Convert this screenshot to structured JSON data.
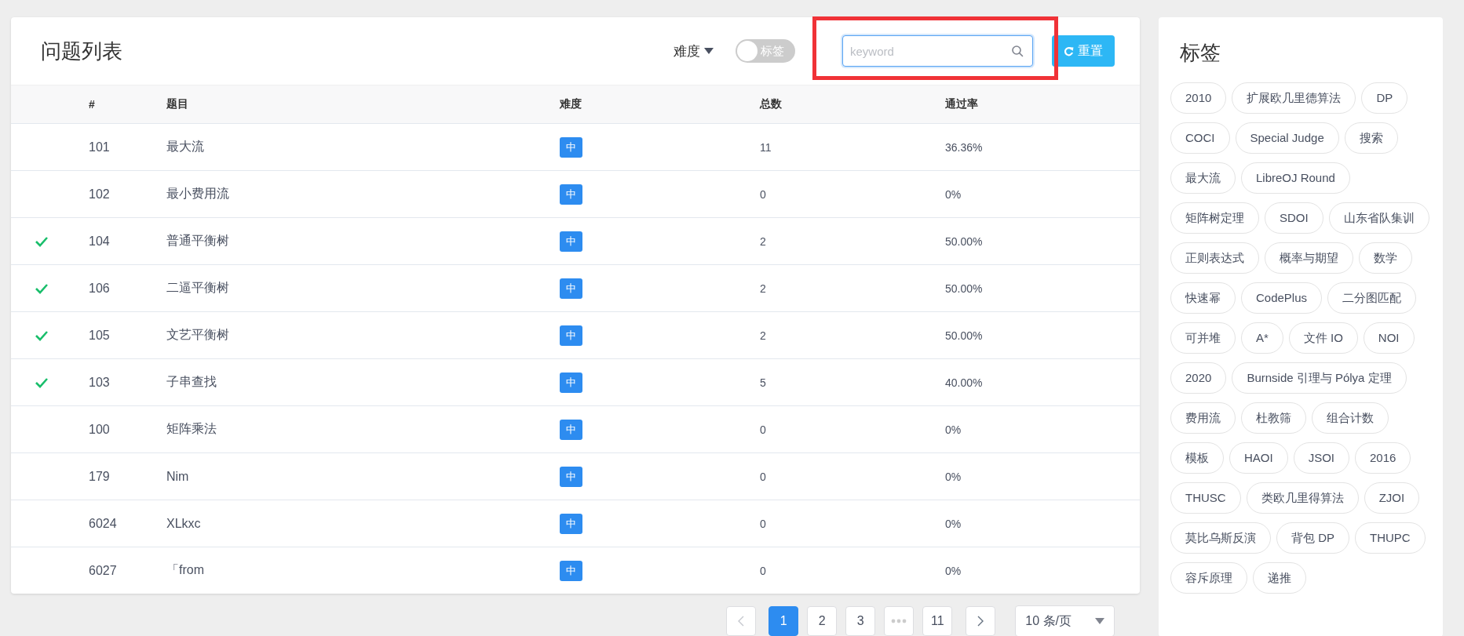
{
  "problem_list": {
    "title": "问题列表",
    "filters": {
      "difficulty": {
        "label": "难度"
      },
      "tag_toggle": {
        "label": "标签",
        "on": false
      },
      "search": {
        "placeholder": "keyword"
      },
      "reset_button": {
        "label": "重置"
      }
    },
    "columns": [
      "#",
      "题目",
      "难度",
      "总数",
      "通过率"
    ],
    "rows": [
      {
        "solved": false,
        "id": "101",
        "title": "最大流",
        "difficulty": "中",
        "total": "11",
        "rate": "36.36%"
      },
      {
        "solved": false,
        "id": "102",
        "title": "最小费用流",
        "difficulty": "中",
        "total": "0",
        "rate": "0%"
      },
      {
        "solved": true,
        "id": "104",
        "title": "普通平衡树",
        "difficulty": "中",
        "total": "2",
        "rate": "50.00%"
      },
      {
        "solved": true,
        "id": "106",
        "title": "二逼平衡树",
        "difficulty": "中",
        "total": "2",
        "rate": "50.00%"
      },
      {
        "solved": true,
        "id": "105",
        "title": "文艺平衡树",
        "difficulty": "中",
        "total": "2",
        "rate": "50.00%"
      },
      {
        "solved": true,
        "id": "103",
        "title": "子串查找",
        "difficulty": "中",
        "total": "5",
        "rate": "40.00%"
      },
      {
        "solved": false,
        "id": "100",
        "title": "矩阵乘法",
        "difficulty": "中",
        "total": "0",
        "rate": "0%"
      },
      {
        "solved": false,
        "id": "179",
        "title": "Nim",
        "difficulty": "中",
        "total": "0",
        "rate": "0%"
      },
      {
        "solved": false,
        "id": "6024",
        "title": "XLkxc",
        "difficulty": "中",
        "total": "0",
        "rate": "0%"
      },
      {
        "solved": false,
        "id": "6027",
        "title": "「from",
        "difficulty": "中",
        "total": "0",
        "rate": "0%"
      }
    ]
  },
  "pagination": {
    "pages": [
      {
        "label": "1",
        "selected": true
      },
      {
        "label": "2",
        "selected": false
      },
      {
        "label": "3",
        "selected": false
      },
      {
        "kind": "ellipsis"
      },
      {
        "label": "11",
        "selected": false
      }
    ],
    "page_size": "10 条/页"
  },
  "tags_panel": {
    "title": "标签",
    "tags": [
      "2010",
      "扩展欧几里德算法",
      "DP",
      "COCI",
      "Special Judge",
      "搜索",
      "最大流",
      "LibreOJ Round",
      "矩阵树定理",
      "SDOI",
      "山东省队集训",
      "正则表达式",
      "概率与期望",
      "数学",
      "快速幂",
      "CodePlus",
      "二分图匹配",
      "可并堆",
      "A*",
      "文件 IO",
      "NOI",
      "2020",
      "Burnside 引理与 Pólya 定理",
      "费用流",
      "杜教筛",
      "组合计数",
      "模板",
      "HAOI",
      "JSOI",
      "2016",
      "THUSC",
      "类欧几里得算法",
      "ZJOI",
      "莫比乌斯反演",
      "背包 DP",
      "THUPC",
      "容斥原理",
      "递推"
    ]
  }
}
